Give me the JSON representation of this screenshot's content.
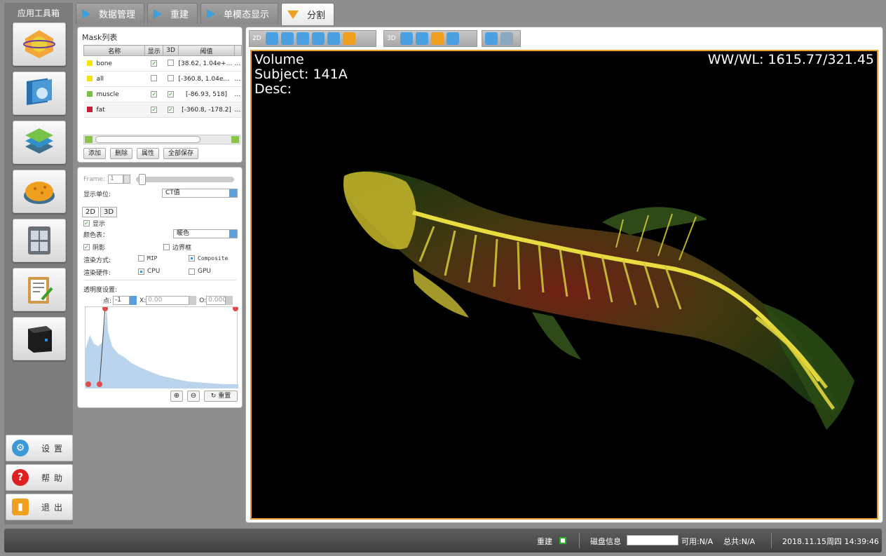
{
  "toolbox": {
    "title": "应用工具箱",
    "tools": [
      "volume-render-icon",
      "slice-view-icon",
      "segmentation-layers-icon",
      "sponge-bone-icon",
      "four-panel-icon",
      "report-clipboard-icon",
      "server-box-icon"
    ],
    "settings_label": "设置",
    "help_label": "帮助",
    "exit_label": "退出"
  },
  "tabs": [
    {
      "label": "数据管理",
      "active": false
    },
    {
      "label": "重建",
      "active": false
    },
    {
      "label": "单模态显示",
      "active": false
    },
    {
      "label": "分割",
      "active": true
    }
  ],
  "mask_panel": {
    "title": "Mask列表",
    "columns": [
      "名称",
      "显示",
      "3D",
      "阈值"
    ],
    "rows": [
      {
        "color": "#f2e400",
        "name": "bone",
        "show": true,
        "three_d": false,
        "threshold": "[38.62, 1.04e+...",
        "more": "..."
      },
      {
        "color": "#f2e400",
        "name": "all",
        "show": false,
        "three_d": false,
        "threshold": "[-360.8, 1.04e...",
        "more": "..."
      },
      {
        "color": "#78c040",
        "name": "muscle",
        "show": true,
        "three_d": true,
        "threshold": "[-86.93, 518]",
        "more": "..."
      },
      {
        "color": "#c0203a",
        "name": "fat",
        "show": true,
        "three_d": true,
        "threshold": "[-360.8, -178.2]",
        "more": "..."
      }
    ],
    "buttons": {
      "add": "添加",
      "delete": "删除",
      "props": "属性",
      "save_all": "全部保存"
    }
  },
  "render_panel": {
    "frame_label": "Frame:",
    "frame_value": "1",
    "unit_label": "显示单位:",
    "unit_value": "CT值",
    "subtab_2d": "2D",
    "subtab_3d": "3D",
    "show_label": "显示",
    "colortable_label": "颜色表：",
    "colortable_value": "暖色",
    "shadow_label": "阴影",
    "bbox_label": "边界框",
    "render_mode_label": "渲染方式:",
    "mip_label": "MIP",
    "composite_label": "Composite",
    "hardware_label": "渲染硬件:",
    "cpu_label": "CPU",
    "gpu_label": "GPU",
    "opacity_label": "透明度设置:",
    "point_label": "点:",
    "point_value": "-1",
    "x_label": "X:",
    "x_value": "0.00",
    "o_label": "O:",
    "o_value": "0.000",
    "reset_label": "重置"
  },
  "viewer": {
    "label_2d": "2D",
    "label_3d": "3D",
    "overlay_line1": "Volume",
    "overlay_line2": "Subject: 141A",
    "overlay_line3": "Desc:",
    "wwwl": "WW/WL: 1615.77/321.45"
  },
  "status": {
    "rebuild_label": "重建",
    "disk_label": "磁盘信息",
    "available": "可用:N/A",
    "total": "总共:N/A",
    "datetime": "2018.11.15周四 14:39:46"
  },
  "colors": {
    "accent_blue": "#3aa0e0",
    "accent_orange": "#f0a020",
    "viewport_border": "#e89b2c"
  }
}
